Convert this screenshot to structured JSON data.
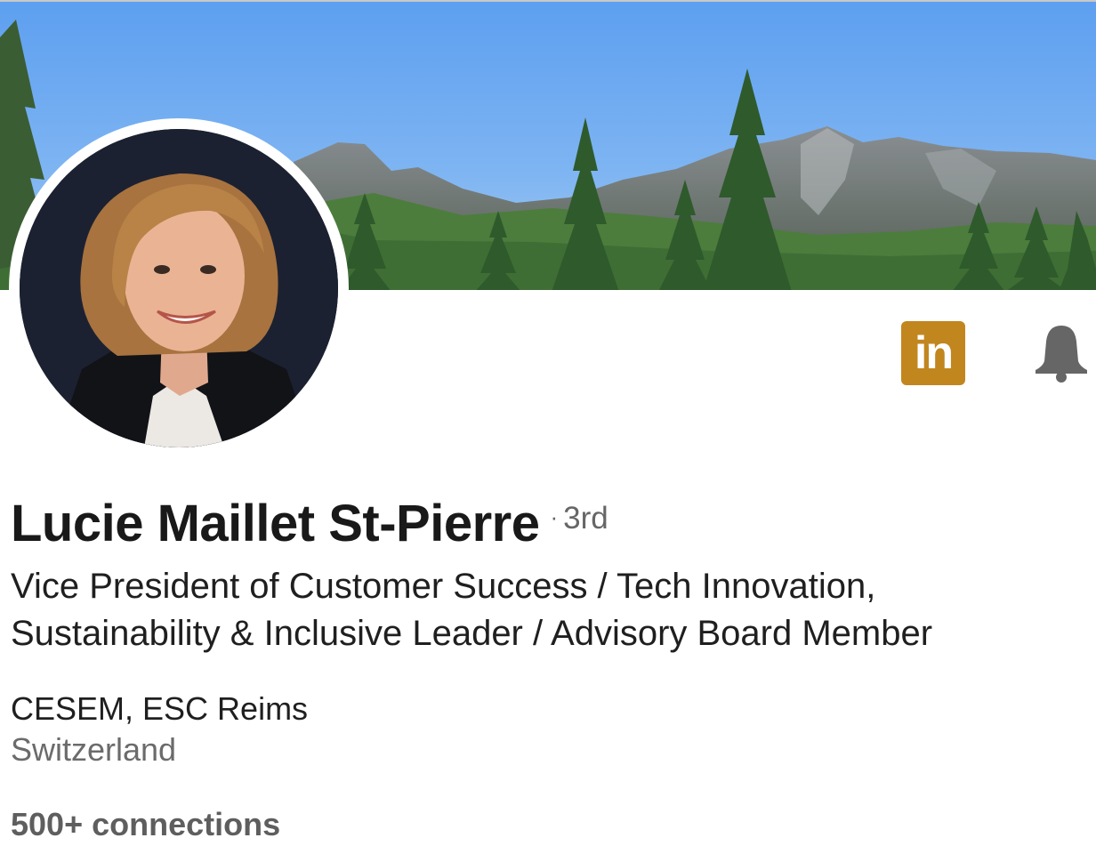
{
  "profile": {
    "name": "Lucie Maillet St-Pierre",
    "degree_separator": "·",
    "degree": "3rd",
    "headline": "Vice President of Customer Success / Tech Innovation, Sustainability & Inclusive Leader / Advisory Board Member",
    "education": "CESEM, ESC Reims",
    "location": "Switzerland",
    "connections": "500+ connections"
  },
  "actions": {
    "linkedin_label": "in",
    "linkedin_icon": "linkedin-icon",
    "bell_icon": "bell-icon"
  },
  "banner": {
    "description_icon": "mountain-landscape-banner"
  },
  "colors": {
    "linkedin_badge": "#c2861f",
    "name_text": "#191919",
    "secondary_text": "#666666",
    "bell": "#666666"
  }
}
